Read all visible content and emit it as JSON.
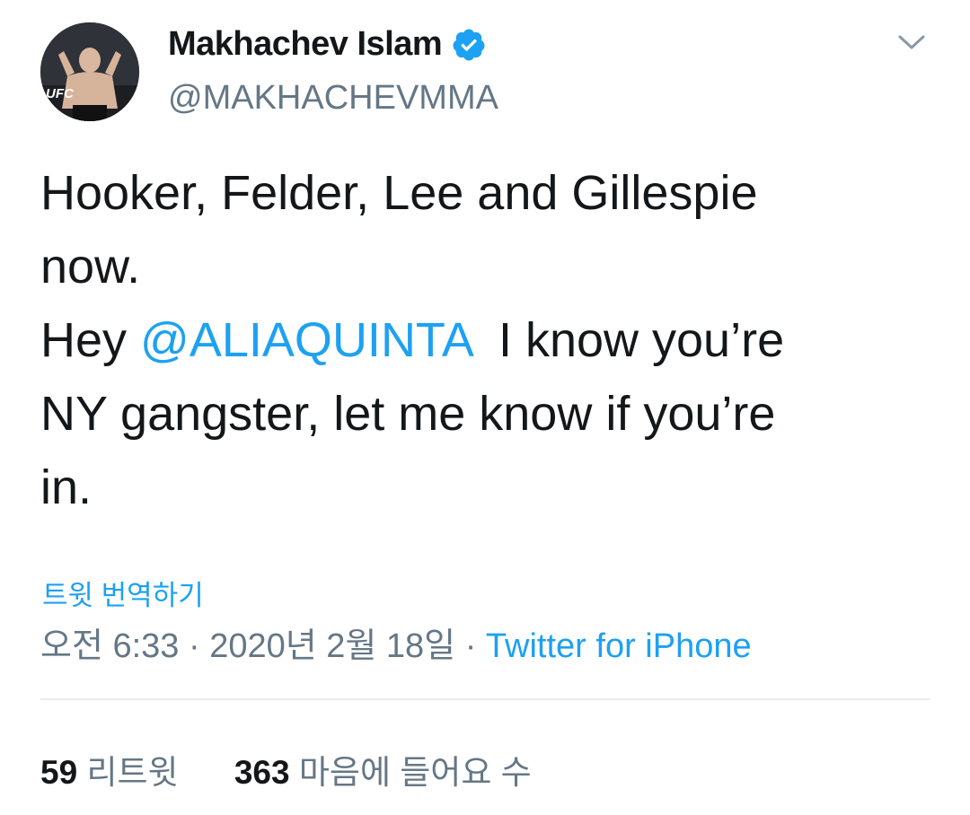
{
  "tweet": {
    "author": {
      "display_name": "Makhachev Islam",
      "handle": "@MAKHACHEVMMA",
      "verified": true,
      "verified_icon": "verified-badge-icon",
      "avatar_badge": "UFC"
    },
    "menu_icon": "chevron-down-icon",
    "text": {
      "line1": "Hooker, Felder, Lee and Gillespie",
      "line2": "now.",
      "line3_prefix": "Hey ",
      "mention": "@ALIAQUINTA",
      "line3_suffix": "  I know you’re",
      "line4": "NY gangster, let me know if you’re",
      "line5": "in."
    },
    "translate_label": "트윗 번역하기",
    "timestamp": "오전 6:33 · 2020년 2월 18일",
    "separator": " · ",
    "source": "Twitter for iPhone",
    "stats": {
      "retweets_count": "59",
      "retweets_label": "리트윗",
      "likes_count": "363",
      "likes_label": "마음에 들어요 수"
    }
  },
  "colors": {
    "accent": "#1da1f2",
    "text": "#14171a",
    "muted": "#657786",
    "divider": "#e6ecf0"
  }
}
